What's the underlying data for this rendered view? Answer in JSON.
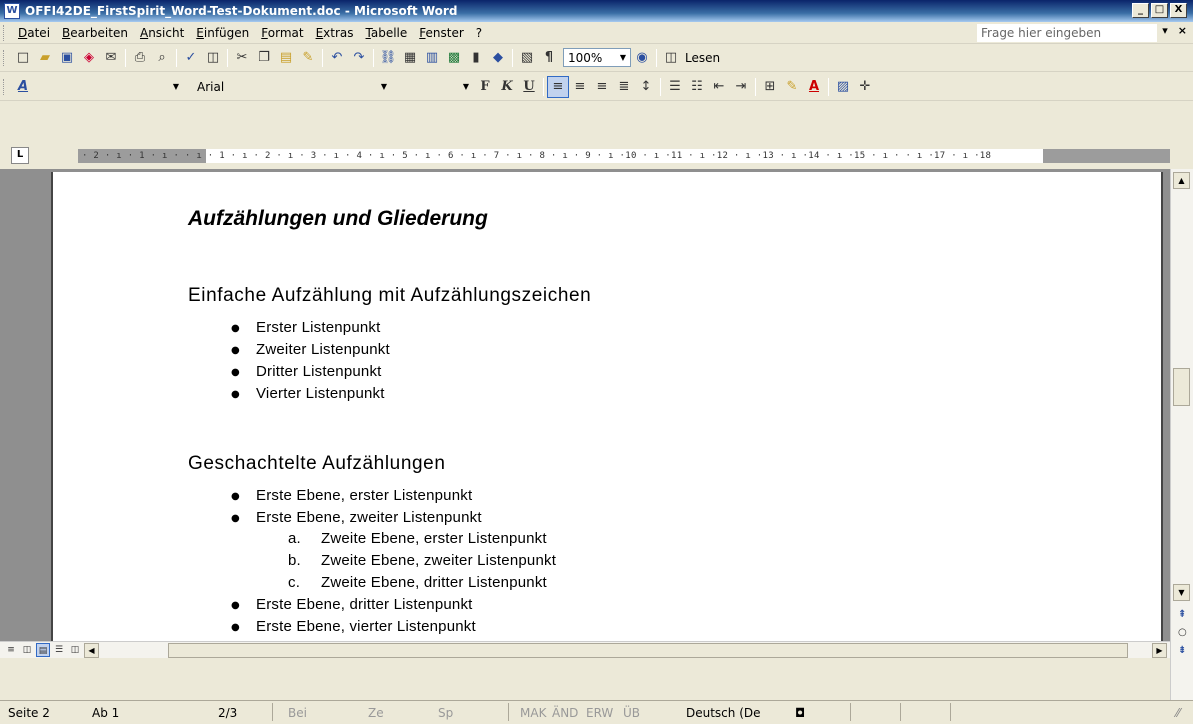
{
  "window": {
    "title": "OFFI42DE_FirstSpirit_Word-Test-Dokument.doc - Microsoft Word",
    "min": "_",
    "max": "□",
    "close": "X"
  },
  "menu": {
    "items": [
      "Datei",
      "Bearbeiten",
      "Ansicht",
      "Einfügen",
      "Format",
      "Extras",
      "Tabelle",
      "Fenster",
      "?"
    ],
    "ask_placeholder": "Frage hier eingeben",
    "close": "×",
    "dropdown": "▾"
  },
  "toolbar_standard": {
    "zoom": "100%",
    "read_label": "Lesen",
    "pilcrow": "¶"
  },
  "toolbar_format": {
    "style": "",
    "font": "Arial",
    "size": "",
    "bold": "F",
    "italic": "K",
    "underline": "U",
    "style_icon": "A"
  },
  "ruler": {
    "tab_type": "L",
    "numbers": "· 2 · ı · 1 · ı ·   · ı · 1 · ı · 2 · ı · 3 · ı · 4 · ı · 5 · ı · 6 · ı · 7 · ı · 8 · ı · 9 · ı ·10 · ı ·11 · ı ·12 · ı ·13 · ı ·14 · ı ·15 · ı ·   · ı ·17 · ı ·18"
  },
  "document": {
    "title": "Aufzählungen und Gliederung",
    "section1": {
      "heading": "Einfache Aufzählung mit Aufzählungszeichen",
      "items": [
        "Erster Listenpunkt",
        "Zweiter Listenpunkt",
        "Dritter Listenpunkt",
        "Vierter Listenpunkt"
      ]
    },
    "section2": {
      "heading": "Geschachtelte Aufzählungen",
      "items": [
        {
          "label": "Erste Ebene, erster Listenpunkt"
        },
        {
          "label": "Erste Ebene, zweiter Listenpunkt"
        },
        {
          "label": "Erste Ebene, dritter Listenpunkt"
        },
        {
          "label": "Erste Ebene, vierter Listenpunkt"
        }
      ],
      "subitems": [
        {
          "marker": "a.",
          "label": "Zweite Ebene, erster Listenpunkt"
        },
        {
          "marker": "b.",
          "label": "Zweite Ebene, zweiter Listenpunkt"
        },
        {
          "marker": "c.",
          "label": "Zweite Ebene, dritter Listenpunkt"
        }
      ]
    }
  },
  "status": {
    "page": "Seite 2",
    "section": "Ab 1",
    "pages": "2/3",
    "at": "Bei",
    "line": "Ze",
    "col": "Sp",
    "rec": "MAK",
    "trk": "ÄND",
    "ext": "ERW",
    "ovr": "ÜB",
    "language": "Deutsch (De"
  }
}
